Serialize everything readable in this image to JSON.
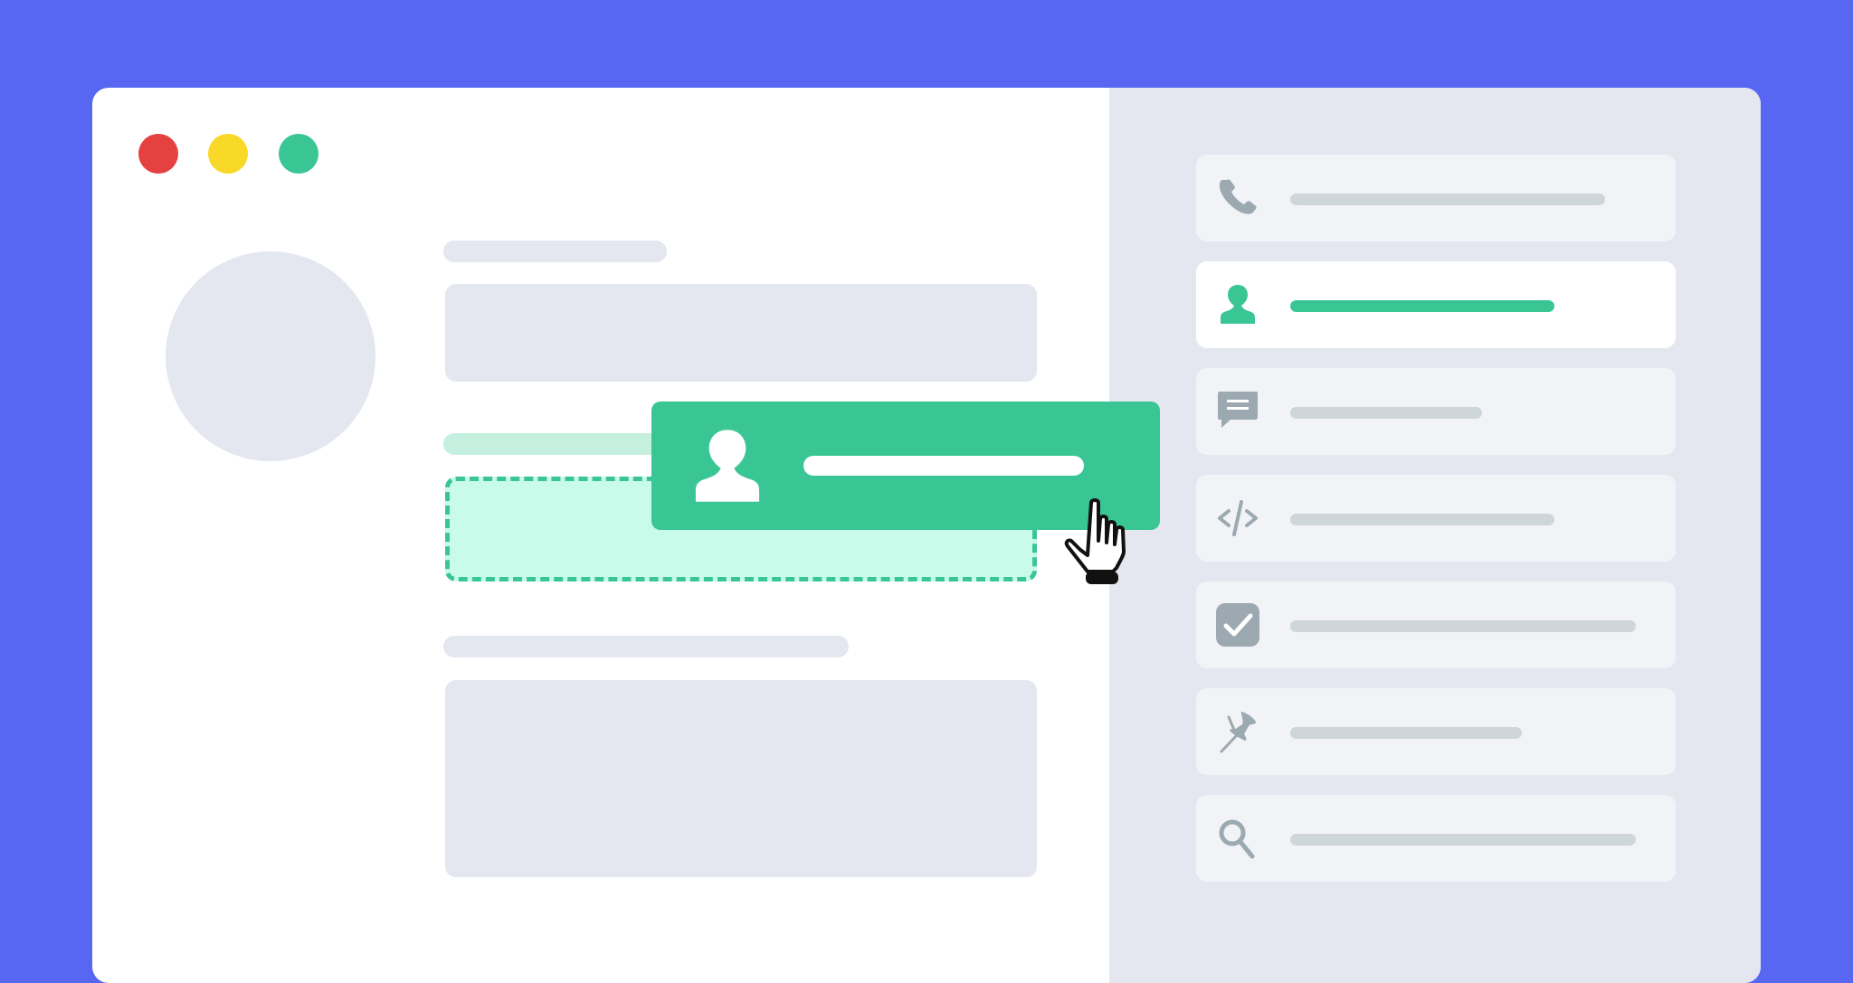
{
  "window": {
    "controls": [
      {
        "name": "close",
        "color": "#e54141"
      },
      {
        "name": "minimize",
        "color": "#f9d927"
      },
      {
        "name": "maximize",
        "color": "#39c694"
      }
    ]
  },
  "colors": {
    "background": "#5867f2",
    "accent": "#3ac694",
    "placeholder": "#e4e7ef",
    "dropzone_fill": "#c9fbea",
    "icon_gray": "#9ca9b1"
  },
  "form": {
    "fields": [
      {
        "label_placeholder": true,
        "input_placeholder": true
      },
      {
        "label_placeholder": true,
        "dropzone": true
      },
      {
        "label_placeholder": true,
        "textarea_placeholder": true
      }
    ]
  },
  "sidebar": {
    "items": [
      {
        "icon": "phone-icon",
        "active": false
      },
      {
        "icon": "user-icon",
        "active": true
      },
      {
        "icon": "message-icon",
        "active": false
      },
      {
        "icon": "code-icon",
        "active": false
      },
      {
        "icon": "checkbox-icon",
        "active": false
      },
      {
        "icon": "pin-icon",
        "active": false
      },
      {
        "icon": "search-icon",
        "active": false
      }
    ]
  },
  "dragged_item": {
    "icon": "user-icon"
  },
  "cursor": {
    "icon": "hand-cursor-icon"
  }
}
